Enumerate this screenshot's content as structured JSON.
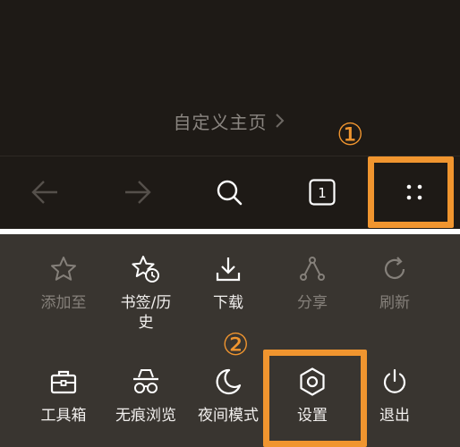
{
  "homepage": {
    "label": "自定义主页",
    "chevron_icon": "chevron-right-icon"
  },
  "toolbar": {
    "back_icon": "arrow-left-icon",
    "forward_icon": "arrow-right-icon",
    "search_icon": "search-icon",
    "tab_count": "1",
    "menu_icon": "four-dots-menu-icon"
  },
  "menu": {
    "row1": [
      {
        "label": "添加至",
        "icon": "star-icon",
        "enabled": false
      },
      {
        "label": "书签/历史",
        "icon": "star-clock-icon",
        "enabled": true
      },
      {
        "label": "下载",
        "icon": "download-icon",
        "enabled": true
      },
      {
        "label": "分享",
        "icon": "share-icon",
        "enabled": false
      },
      {
        "label": "刷新",
        "icon": "refresh-icon",
        "enabled": false
      }
    ],
    "row2": [
      {
        "label": "工具箱",
        "icon": "toolbox-icon",
        "enabled": true
      },
      {
        "label": "无痕浏览",
        "icon": "incognito-icon",
        "enabled": true
      },
      {
        "label": "夜间模式",
        "icon": "moon-icon",
        "enabled": true
      },
      {
        "label": "设置",
        "icon": "gear-icon",
        "enabled": true
      },
      {
        "label": "退出",
        "icon": "power-icon",
        "enabled": true
      }
    ]
  },
  "annotations": {
    "step1": "①",
    "step2": "②",
    "highlight_color": "#f0952f"
  },
  "colors": {
    "top_background": "#1e1a16",
    "menu_background": "#393530",
    "enabled_text": "#f2f0ee",
    "disabled_text": "#85807a"
  }
}
